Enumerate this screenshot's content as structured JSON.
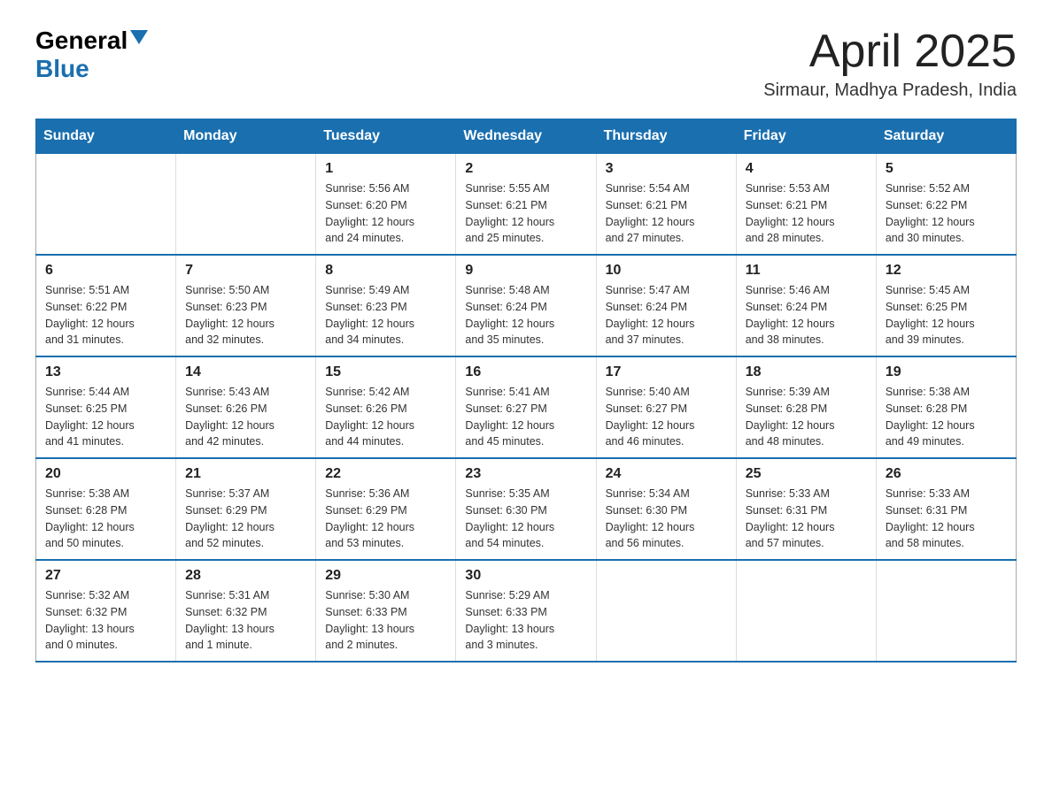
{
  "header": {
    "logo_general": "General",
    "logo_blue": "Blue",
    "month_year": "April 2025",
    "location": "Sirmaur, Madhya Pradesh, India"
  },
  "days_of_week": [
    "Sunday",
    "Monday",
    "Tuesday",
    "Wednesday",
    "Thursday",
    "Friday",
    "Saturday"
  ],
  "weeks": [
    [
      {
        "day": "",
        "info": ""
      },
      {
        "day": "",
        "info": ""
      },
      {
        "day": "1",
        "info": "Sunrise: 5:56 AM\nSunset: 6:20 PM\nDaylight: 12 hours\nand 24 minutes."
      },
      {
        "day": "2",
        "info": "Sunrise: 5:55 AM\nSunset: 6:21 PM\nDaylight: 12 hours\nand 25 minutes."
      },
      {
        "day": "3",
        "info": "Sunrise: 5:54 AM\nSunset: 6:21 PM\nDaylight: 12 hours\nand 27 minutes."
      },
      {
        "day": "4",
        "info": "Sunrise: 5:53 AM\nSunset: 6:21 PM\nDaylight: 12 hours\nand 28 minutes."
      },
      {
        "day": "5",
        "info": "Sunrise: 5:52 AM\nSunset: 6:22 PM\nDaylight: 12 hours\nand 30 minutes."
      }
    ],
    [
      {
        "day": "6",
        "info": "Sunrise: 5:51 AM\nSunset: 6:22 PM\nDaylight: 12 hours\nand 31 minutes."
      },
      {
        "day": "7",
        "info": "Sunrise: 5:50 AM\nSunset: 6:23 PM\nDaylight: 12 hours\nand 32 minutes."
      },
      {
        "day": "8",
        "info": "Sunrise: 5:49 AM\nSunset: 6:23 PM\nDaylight: 12 hours\nand 34 minutes."
      },
      {
        "day": "9",
        "info": "Sunrise: 5:48 AM\nSunset: 6:24 PM\nDaylight: 12 hours\nand 35 minutes."
      },
      {
        "day": "10",
        "info": "Sunrise: 5:47 AM\nSunset: 6:24 PM\nDaylight: 12 hours\nand 37 minutes."
      },
      {
        "day": "11",
        "info": "Sunrise: 5:46 AM\nSunset: 6:24 PM\nDaylight: 12 hours\nand 38 minutes."
      },
      {
        "day": "12",
        "info": "Sunrise: 5:45 AM\nSunset: 6:25 PM\nDaylight: 12 hours\nand 39 minutes."
      }
    ],
    [
      {
        "day": "13",
        "info": "Sunrise: 5:44 AM\nSunset: 6:25 PM\nDaylight: 12 hours\nand 41 minutes."
      },
      {
        "day": "14",
        "info": "Sunrise: 5:43 AM\nSunset: 6:26 PM\nDaylight: 12 hours\nand 42 minutes."
      },
      {
        "day": "15",
        "info": "Sunrise: 5:42 AM\nSunset: 6:26 PM\nDaylight: 12 hours\nand 44 minutes."
      },
      {
        "day": "16",
        "info": "Sunrise: 5:41 AM\nSunset: 6:27 PM\nDaylight: 12 hours\nand 45 minutes."
      },
      {
        "day": "17",
        "info": "Sunrise: 5:40 AM\nSunset: 6:27 PM\nDaylight: 12 hours\nand 46 minutes."
      },
      {
        "day": "18",
        "info": "Sunrise: 5:39 AM\nSunset: 6:28 PM\nDaylight: 12 hours\nand 48 minutes."
      },
      {
        "day": "19",
        "info": "Sunrise: 5:38 AM\nSunset: 6:28 PM\nDaylight: 12 hours\nand 49 minutes."
      }
    ],
    [
      {
        "day": "20",
        "info": "Sunrise: 5:38 AM\nSunset: 6:28 PM\nDaylight: 12 hours\nand 50 minutes."
      },
      {
        "day": "21",
        "info": "Sunrise: 5:37 AM\nSunset: 6:29 PM\nDaylight: 12 hours\nand 52 minutes."
      },
      {
        "day": "22",
        "info": "Sunrise: 5:36 AM\nSunset: 6:29 PM\nDaylight: 12 hours\nand 53 minutes."
      },
      {
        "day": "23",
        "info": "Sunrise: 5:35 AM\nSunset: 6:30 PM\nDaylight: 12 hours\nand 54 minutes."
      },
      {
        "day": "24",
        "info": "Sunrise: 5:34 AM\nSunset: 6:30 PM\nDaylight: 12 hours\nand 56 minutes."
      },
      {
        "day": "25",
        "info": "Sunrise: 5:33 AM\nSunset: 6:31 PM\nDaylight: 12 hours\nand 57 minutes."
      },
      {
        "day": "26",
        "info": "Sunrise: 5:33 AM\nSunset: 6:31 PM\nDaylight: 12 hours\nand 58 minutes."
      }
    ],
    [
      {
        "day": "27",
        "info": "Sunrise: 5:32 AM\nSunset: 6:32 PM\nDaylight: 13 hours\nand 0 minutes."
      },
      {
        "day": "28",
        "info": "Sunrise: 5:31 AM\nSunset: 6:32 PM\nDaylight: 13 hours\nand 1 minute."
      },
      {
        "day": "29",
        "info": "Sunrise: 5:30 AM\nSunset: 6:33 PM\nDaylight: 13 hours\nand 2 minutes."
      },
      {
        "day": "30",
        "info": "Sunrise: 5:29 AM\nSunset: 6:33 PM\nDaylight: 13 hours\nand 3 minutes."
      },
      {
        "day": "",
        "info": ""
      },
      {
        "day": "",
        "info": ""
      },
      {
        "day": "",
        "info": ""
      }
    ]
  ]
}
